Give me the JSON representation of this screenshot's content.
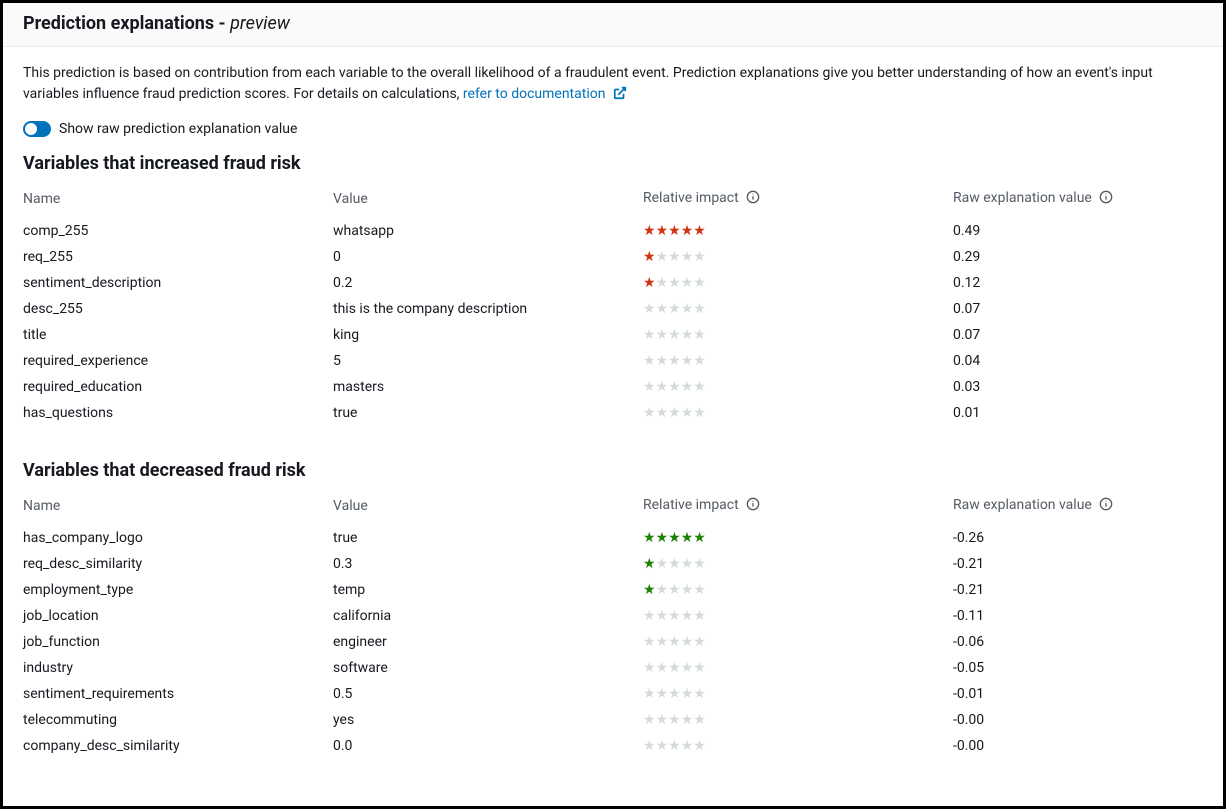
{
  "header": {
    "title_main": "Prediction explanations -",
    "title_preview": "preview"
  },
  "intro": {
    "text": "This prediction is based on contribution from each variable to the overall likelihood of a fraudulent event. Prediction explanations give you better understanding of how an event's input variables influence fraud prediction scores. For details on calculations, ",
    "link_text": "refer to documentation"
  },
  "toggle": {
    "label": "Show raw prediction explanation value",
    "on": true
  },
  "columns": {
    "name": "Name",
    "value": "Value",
    "impact": "Relative impact",
    "raw": "Raw explanation value"
  },
  "sections": {
    "increased_heading": "Variables that increased fraud risk",
    "decreased_heading": "Variables that decreased fraud risk"
  },
  "increased": [
    {
      "name": "comp_255",
      "value": "whatsapp",
      "impact": 5,
      "raw": "0.49"
    },
    {
      "name": "req_255",
      "value": "0",
      "impact": 1,
      "raw": "0.29"
    },
    {
      "name": "sentiment_description",
      "value": "0.2",
      "impact": 1,
      "raw": "0.12"
    },
    {
      "name": "desc_255",
      "value": "this is the company description",
      "impact": 0,
      "raw": "0.07"
    },
    {
      "name": "title",
      "value": "king",
      "impact": 0,
      "raw": "0.07"
    },
    {
      "name": "required_experience",
      "value": "5",
      "impact": 0,
      "raw": "0.04"
    },
    {
      "name": "required_education",
      "value": "masters",
      "impact": 0,
      "raw": "0.03"
    },
    {
      "name": "has_questions",
      "value": "true",
      "impact": 0,
      "raw": "0.01"
    }
  ],
  "decreased": [
    {
      "name": "has_company_logo",
      "value": "true",
      "impact": 5,
      "raw": "-0.26"
    },
    {
      "name": "req_desc_similarity",
      "value": "0.3",
      "impact": 1,
      "raw": "-0.21"
    },
    {
      "name": "employment_type",
      "value": "temp",
      "impact": 1,
      "raw": "-0.21"
    },
    {
      "name": "job_location",
      "value": "california",
      "impact": 0,
      "raw": "-0.11"
    },
    {
      "name": "job_function",
      "value": "engineer",
      "impact": 0,
      "raw": "-0.06"
    },
    {
      "name": "industry",
      "value": "software",
      "impact": 0,
      "raw": "-0.05"
    },
    {
      "name": "sentiment_requirements",
      "value": "0.5",
      "impact": 0,
      "raw": "-0.01"
    },
    {
      "name": "telecommuting",
      "value": "yes",
      "impact": 0,
      "raw": "-0.00"
    },
    {
      "name": "company_desc_similarity",
      "value": "0.0",
      "impact": 0,
      "raw": "-0.00"
    }
  ]
}
